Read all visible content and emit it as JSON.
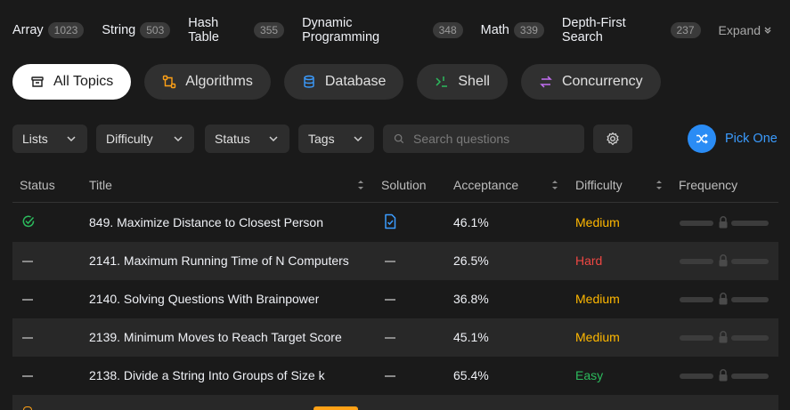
{
  "tags": [
    {
      "name": "Array",
      "count": "1023"
    },
    {
      "name": "String",
      "count": "503"
    },
    {
      "name": "Hash Table",
      "count": "355"
    },
    {
      "name": "Dynamic Programming",
      "count": "348"
    },
    {
      "name": "Math",
      "count": "339"
    },
    {
      "name": "Depth-First Search",
      "count": "237"
    }
  ],
  "expand_label": "Expand",
  "topics": [
    {
      "label": "All Topics",
      "icon": "stack-icon",
      "color": "#1a1a1a",
      "active": true
    },
    {
      "label": "Algorithms",
      "icon": "algorithm-icon",
      "color": "#ffa116"
    },
    {
      "label": "Database",
      "icon": "database-icon",
      "color": "#3b9cff"
    },
    {
      "label": "Shell",
      "icon": "terminal-icon",
      "color": "#2cbb5d"
    },
    {
      "label": "Concurrency",
      "icon": "concurrency-icon",
      "color": "#c36ff2"
    }
  ],
  "filters": {
    "lists": "Lists",
    "difficulty": "Difficulty",
    "status": "Status",
    "tags": "Tags",
    "search_placeholder": "Search questions",
    "pick_one": "Pick One"
  },
  "columns": {
    "status": "Status",
    "title": "Title",
    "solution": "Solution",
    "acceptance": "Acceptance",
    "difficulty": "Difficulty",
    "frequency": "Frequency"
  },
  "rows": [
    {
      "status": "solved",
      "title": "849. Maximize Distance to Closest Person",
      "solution": "video-icon",
      "acceptance": "46.1%",
      "difficulty": "Medium"
    },
    {
      "status": "none",
      "title": "2141. Maximum Running Time of N Computers",
      "solution": "none",
      "acceptance": "26.5%",
      "difficulty": "Hard"
    },
    {
      "status": "none",
      "title": "2140. Solving Questions With Brainpower",
      "solution": "none",
      "acceptance": "36.8%",
      "difficulty": "Medium"
    },
    {
      "status": "none",
      "title": "2139. Minimum Moves to Reach Target Score",
      "solution": "none",
      "acceptance": "45.1%",
      "difficulty": "Medium"
    },
    {
      "status": "none",
      "title": "2138. Divide a String Into Groups of Size k",
      "solution": "none",
      "acceptance": "65.4%",
      "difficulty": "Easy"
    }
  ],
  "colors": {
    "background": "#1a1a1a",
    "accent_blue": "#2a8cf5",
    "medium": "#ffb800",
    "hard": "#ef4743",
    "easy": "#2cbb5d"
  }
}
